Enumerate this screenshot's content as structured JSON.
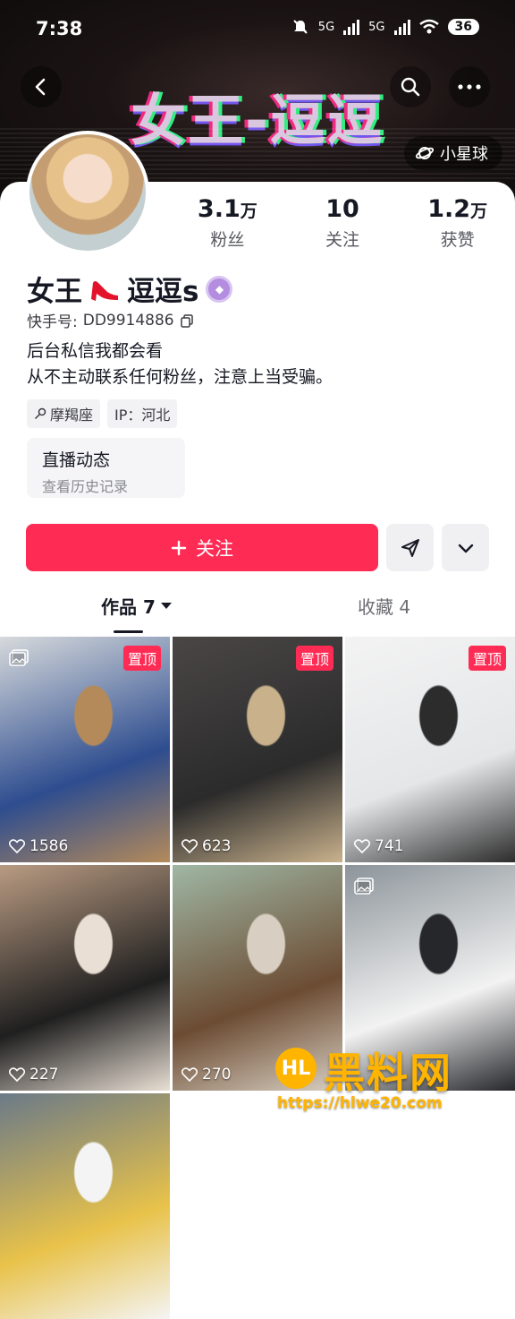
{
  "status_bar": {
    "time": "7:38",
    "network_1": "5G",
    "network_2": "5G",
    "battery": "36"
  },
  "banner": {
    "title": "女王-逗逗",
    "planet_label": "小星球"
  },
  "profile": {
    "stats": [
      {
        "num": "3.1",
        "unit": "万",
        "label": "粉丝"
      },
      {
        "num": "10",
        "unit": "",
        "label": "关注"
      },
      {
        "num": "1.2",
        "unit": "万",
        "label": "获赞"
      }
    ],
    "name_before": "女王",
    "name_after": "逗逗s",
    "uid_label": "快手号:",
    "uid_value": "DD9914886",
    "bio_line1": "后台私信我都会看",
    "bio_line2": "从不主动联系任何粉丝，注意上当受骗。",
    "tag_zodiac": "摩羯座",
    "tag_ip": "IP：河北",
    "live_title": "直播动态",
    "live_sub": "查看历史记录"
  },
  "actions": {
    "follow_label": "关注"
  },
  "tabs": {
    "works": "作品 7",
    "favorites": "收藏 4"
  },
  "posts": [
    {
      "likes": "1586",
      "pinned": "置顶",
      "colors": [
        "#d7dadc",
        "#2e4d8f",
        "#b48a5a"
      ]
    },
    {
      "likes": "623",
      "pinned": "置顶",
      "colors": [
        "#4a4646",
        "#2b2b2b",
        "#c9b18c"
      ]
    },
    {
      "likes": "741",
      "pinned": "置顶",
      "colors": [
        "#f3f3f3",
        "#e4e6e8",
        "#2c2c2c"
      ]
    },
    {
      "likes": "227",
      "pinned": "",
      "colors": [
        "#b99b82",
        "#1f1f1f",
        "#e9dfd4"
      ]
    },
    {
      "likes": "270",
      "pinned": "",
      "colors": [
        "#9fb7a4",
        "#6c4c33",
        "#d8cfc2"
      ]
    },
    {
      "likes": "",
      "pinned": "",
      "colors": [
        "#8c949a",
        "#f2f2f2",
        "#26272b"
      ]
    },
    {
      "likes": "",
      "pinned": "",
      "colors": [
        "#6b7a88",
        "#e8c24a",
        "#f4f4f4"
      ]
    }
  ],
  "watermark": {
    "logo": "HL",
    "text": "黑料网",
    "url": "https://hlwe20.com"
  },
  "colors": {
    "accent": "#fe2c55",
    "watermark": "#ffb400"
  }
}
